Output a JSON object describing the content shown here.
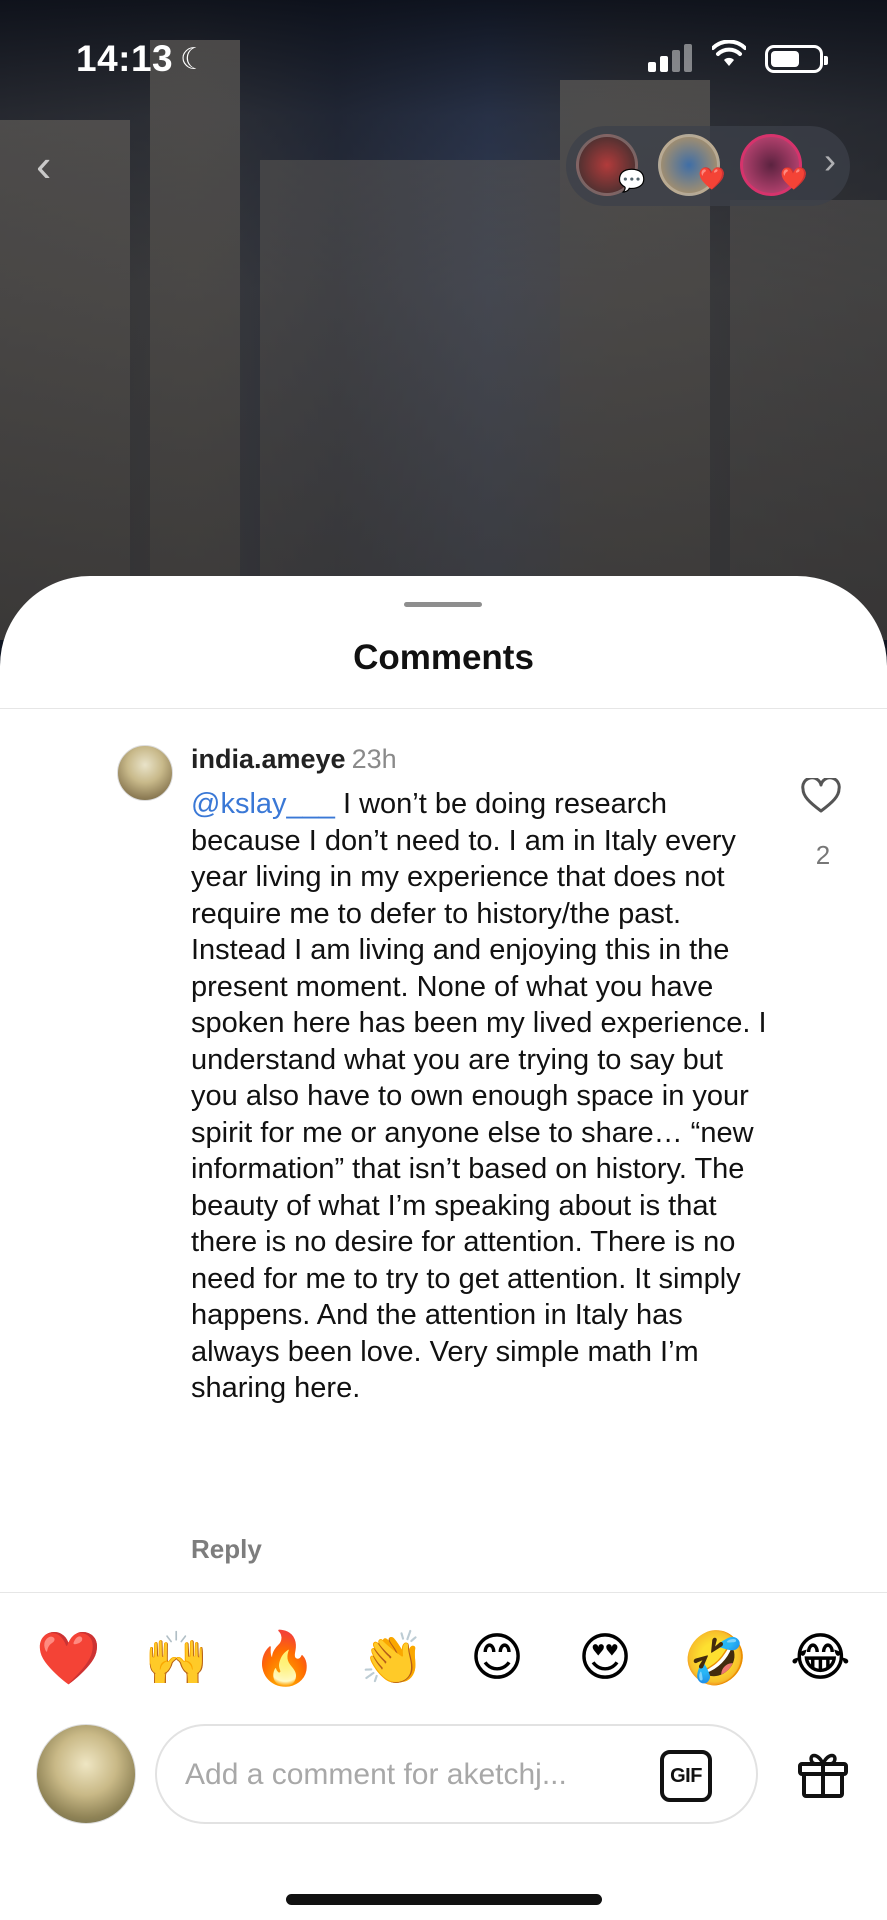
{
  "status_bar": {
    "time": "14:13"
  },
  "icons": {
    "moon": "moon-icon",
    "signal": "signal-icon",
    "wifi": "wifi-icon",
    "battery": "battery-icon",
    "back": "chevron-left-icon",
    "forward": "chevron-right-icon",
    "like": "heart-outline-icon",
    "gif": "gif-icon",
    "gift": "gift-icon"
  },
  "sheet": {
    "title": "Comments"
  },
  "comment": {
    "username": "india.ameye",
    "time": "23h",
    "mention": "@kslay___",
    "text": " I won’t be doing research because I don’t need to. I am in Italy every year living in my experience that does not require me to defer to history/the past. Instead I am living and enjoying this in the present moment.  None of what you have spoken here has been my lived experience. I understand what you are trying to say but you also have to own enough space in your spirit for me or anyone else to share… “new information” that isn’t based on history. The beauty of what I’m speaking about is that there is no desire for attention. There is no need for me to try to get attention. It simply happens. And the attention in Italy has always been love. Very simple math I’m sharing here.",
    "reply_label": "Reply",
    "like_count": "2"
  },
  "quick_reactions": [
    "❤️",
    "🙌",
    "🔥",
    "👏",
    "😊",
    "😍",
    "🤣",
    "😂"
  ],
  "composer": {
    "placeholder": "Add a comment for aketchj...",
    "gif_label": "GIF"
  },
  "colors": {
    "mention": "#3a78d6",
    "sheet_bg": "#ffffff",
    "muted_text": "#8a8a8a"
  }
}
